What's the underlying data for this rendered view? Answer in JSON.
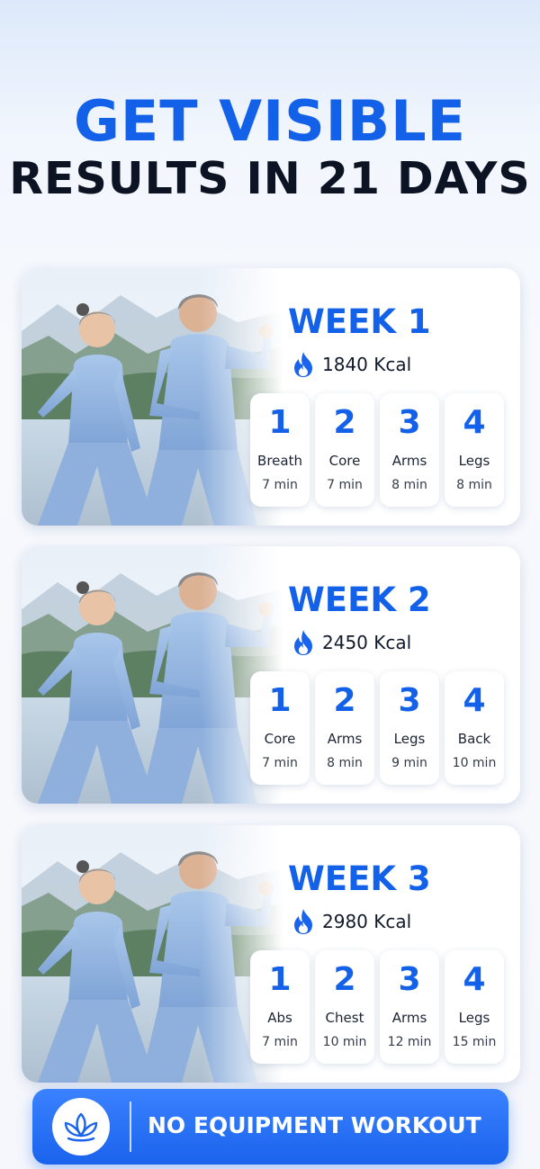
{
  "headline": {
    "line1": "GET VISIBLE",
    "line2": "RESULTS IN 21 DAYS"
  },
  "colors": {
    "accent": "#1261E8",
    "dark_text": "#0C1424",
    "card_bg": "#FFFFFF"
  },
  "weeks": [
    {
      "title": "WEEK 1",
      "kcal": "1840 Kcal",
      "icon": "flame-icon",
      "days": [
        {
          "num": "1",
          "name": "Breath",
          "duration": "7 min"
        },
        {
          "num": "2",
          "name": "Core",
          "duration": "7 min"
        },
        {
          "num": "3",
          "name": "Arms",
          "duration": "8 min"
        },
        {
          "num": "4",
          "name": "Legs",
          "duration": "8 min"
        }
      ]
    },
    {
      "title": "WEEK 2",
      "kcal": "2450 Kcal",
      "icon": "flame-icon",
      "days": [
        {
          "num": "1",
          "name": "Core",
          "duration": "7 min"
        },
        {
          "num": "2",
          "name": "Arms",
          "duration": "8 min"
        },
        {
          "num": "3",
          "name": "Legs",
          "duration": "9 min"
        },
        {
          "num": "4",
          "name": "Back",
          "duration": "10 min"
        }
      ]
    },
    {
      "title": "WEEK 3",
      "kcal": "2980 Kcal",
      "icon": "flame-icon",
      "days": [
        {
          "num": "1",
          "name": "Abs",
          "duration": "7 min"
        },
        {
          "num": "2",
          "name": "Chest",
          "duration": "10 min"
        },
        {
          "num": "3",
          "name": "Arms",
          "duration": "12 min"
        },
        {
          "num": "4",
          "name": "Legs",
          "duration": "15 min"
        }
      ]
    }
  ],
  "cta": {
    "label": "NO EQUIPMENT WORKOUT",
    "icon": "lotus-icon"
  }
}
